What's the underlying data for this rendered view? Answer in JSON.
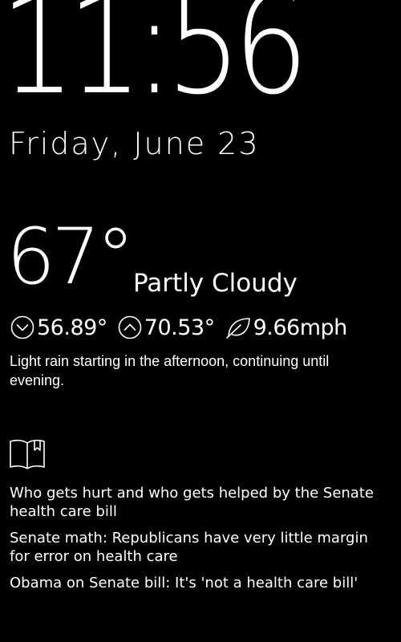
{
  "clock": {
    "time": "11:56",
    "date": "Friday, June 23"
  },
  "weather": {
    "temperature": "67°",
    "summary": "Partly Cloudy",
    "low": "56.89°",
    "high": "70.53°",
    "wind": "9.66mph",
    "description": "Light rain starting in the afternoon, continuing until evening.",
    "icons": {
      "low": "chevron-down-circle-icon",
      "high": "chevron-up-circle-icon",
      "wind": "leaf-icon"
    }
  },
  "news": {
    "icon": "open-book-icon",
    "headlines": [
      "Who gets hurt and who gets helped by the Senate health care bill",
      "Senate math: Republicans have very little margin for error on health care",
      "Obama on Senate bill: It's 'not a health care bill'"
    ]
  },
  "colors": {
    "background": "#000000",
    "foreground": "#ffffff"
  }
}
